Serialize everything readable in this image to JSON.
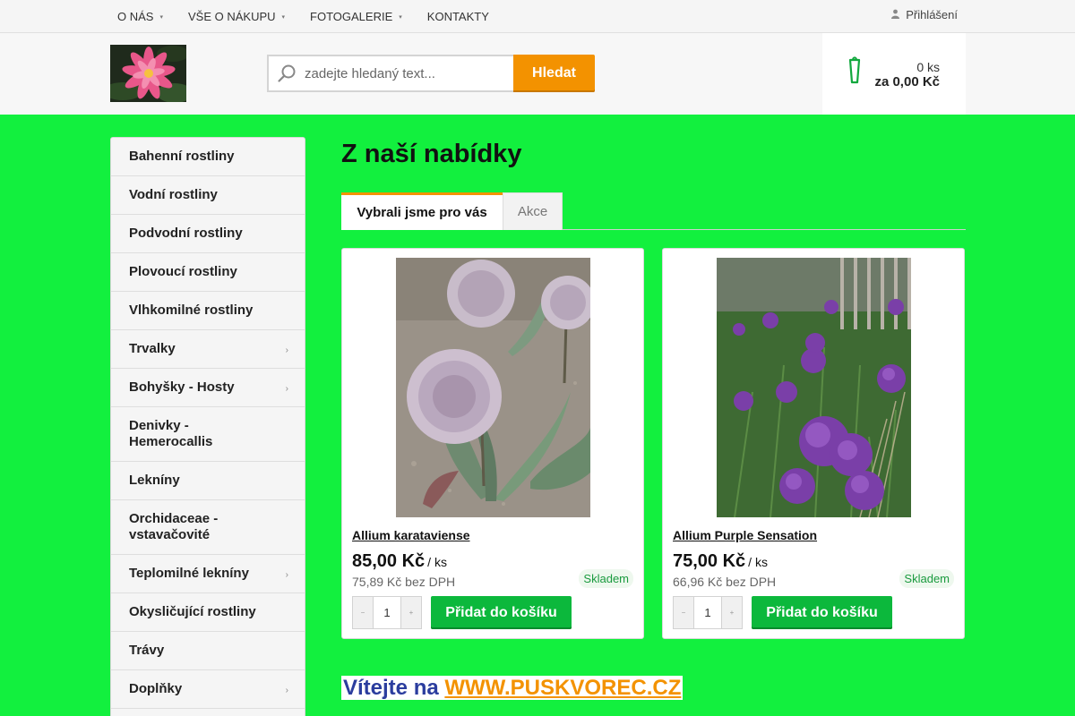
{
  "topnav": {
    "items": [
      {
        "label": "O NÁS",
        "has_menu": true
      },
      {
        "label": "VŠE O NÁKUPU",
        "has_menu": true
      },
      {
        "label": "FOTOGALERIE",
        "has_menu": true
      },
      {
        "label": "KONTAKTY",
        "has_menu": false
      }
    ],
    "login_label": "Přihlášení",
    "user_icon": "user-icon",
    "caret_glyph": "▾"
  },
  "search": {
    "placeholder": "zadejte hledaný text...",
    "button_label": "Hledat",
    "icon": "search-icon"
  },
  "cart": {
    "count": "0 ks",
    "total": "za 0,00 Kč",
    "icon": "shopping-cart-icon"
  },
  "sidebar": {
    "items": [
      {
        "label": "Bahenní rostliny",
        "submenu": false
      },
      {
        "label": "Vodní rostliny",
        "submenu": false
      },
      {
        "label": "Podvodní rostliny",
        "submenu": false
      },
      {
        "label": "Plovoucí rostliny",
        "submenu": false
      },
      {
        "label": "Vlhkomilné rostliny",
        "submenu": false
      },
      {
        "label": "Trvalky",
        "submenu": true
      },
      {
        "label": "Bohyšky - Hosty",
        "submenu": true
      },
      {
        "label": "Denivky - Hemerocallis",
        "submenu": false
      },
      {
        "label": "Lekníny",
        "submenu": false
      },
      {
        "label": "Orchidaceae - vstavačovité",
        "submenu": false
      },
      {
        "label": "Teplomilné lekníny",
        "submenu": true
      },
      {
        "label": "Okysličující rostliny",
        "submenu": false
      },
      {
        "label": "Trávy",
        "submenu": false
      },
      {
        "label": "Doplňky",
        "submenu": true
      }
    ],
    "arrow_glyph": "›"
  },
  "main": {
    "title": "Z naší nabídky",
    "tabs": [
      "Vybrali jsme pro vás",
      "Akce"
    ],
    "products": [
      {
        "name": "Allium karataviense",
        "price": "85,00 Kč",
        "unit": "/ ks",
        "net_price": "75,89 Kč bez DPH",
        "stock": "Skladem",
        "quantity": "1",
        "add_label": "Přidat do košíku"
      },
      {
        "name": "Allium Purple Sensation",
        "price": "75,00 Kč",
        "unit": "/ ks",
        "net_price": "66,96 Kč bez DPH",
        "stock": "Skladem",
        "quantity": "1",
        "add_label": "Přidat do košíku"
      }
    ],
    "stepper": {
      "minus": "−",
      "plus": "+"
    },
    "welcome": {
      "prefix": "Vítejte na ",
      "link": "WWW.PUSKVOREC.CZ"
    }
  },
  "colors": {
    "page_bg": "#12f03e",
    "accent_orange": "#f39200",
    "button_green": "#0cb83c",
    "welcome_blue": "#2b3d9e"
  }
}
